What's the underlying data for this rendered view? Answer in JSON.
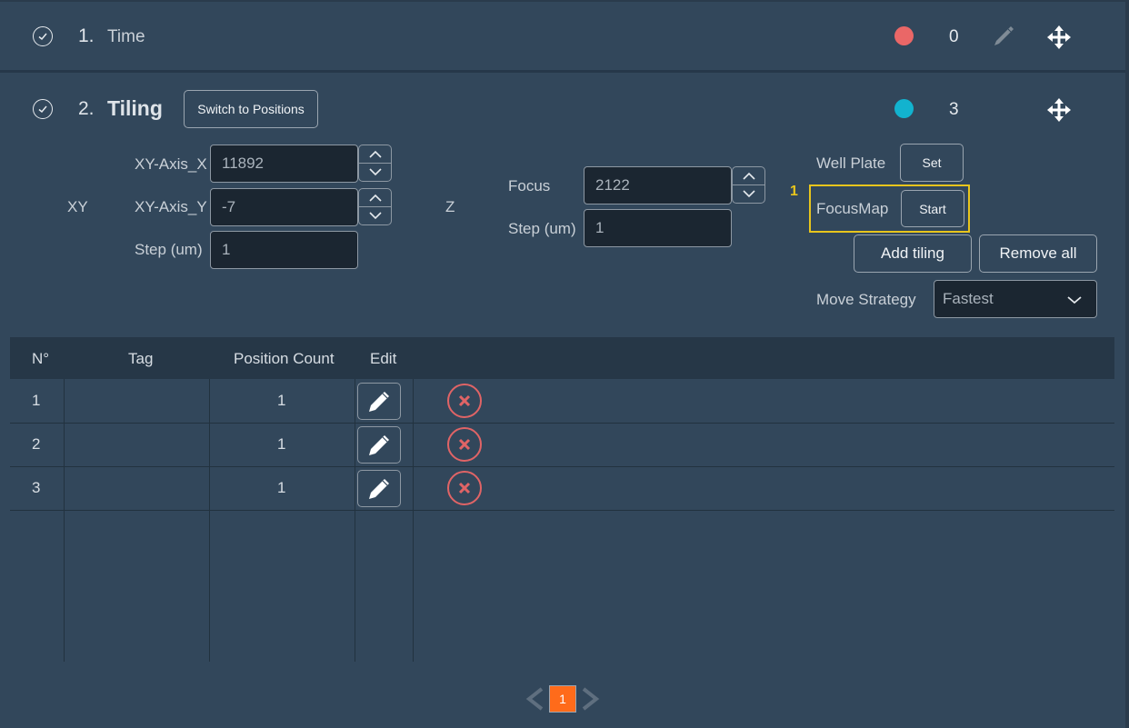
{
  "steps": [
    {
      "number": "1.",
      "title": "Time",
      "status_color": "#ea6767",
      "count": "0"
    },
    {
      "number": "2.",
      "title": "Tiling",
      "switch_button": "Switch to Positions",
      "status_color": "#12b3cf",
      "count": "3"
    }
  ],
  "xy_control": {
    "label": "XY",
    "arrow_color": "#14acc8",
    "fields": [
      {
        "label": "XY-Axis_X",
        "value": "11892"
      },
      {
        "label": "XY-Axis_Y",
        "value": "-7"
      },
      {
        "label": "Step (um)",
        "value": "1"
      }
    ]
  },
  "z_control": {
    "label": "Z",
    "fields": [
      {
        "label": "Focus",
        "value": "2122"
      },
      {
        "label": "Step (um)",
        "value": "1"
      }
    ]
  },
  "side_controls": {
    "well_plate_label": "Well Plate",
    "well_plate_button": "Set",
    "annotation_number": "1",
    "highlight_color": "#e8c51c",
    "focusmap_label": "FocusMap",
    "focusmap_button": "Start",
    "add_tiling": "Add tiling",
    "remove_all": "Remove all",
    "move_strategy_label": "Move Strategy",
    "move_strategy_value": "Fastest"
  },
  "table": {
    "headers": [
      "N°",
      "Tag",
      "Position Count",
      "Edit"
    ],
    "rows": [
      {
        "no": "1",
        "tag": "",
        "count": "1"
      },
      {
        "no": "2",
        "tag": "",
        "count": "1"
      },
      {
        "no": "3",
        "tag": "",
        "count": "1"
      }
    ],
    "delete_color": "#e06466"
  },
  "pagination": {
    "current_page": "1",
    "active_color": "#ff6b1a"
  }
}
